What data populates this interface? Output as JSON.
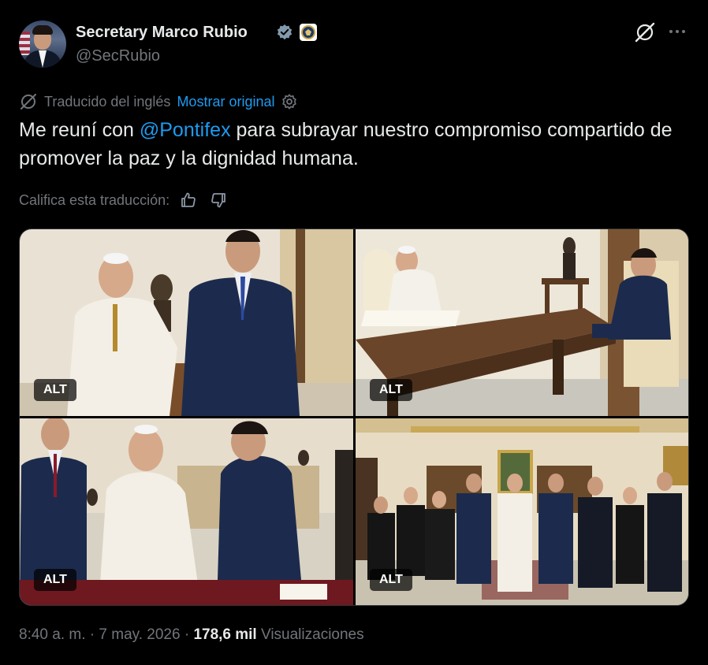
{
  "author": {
    "name": "Secretary Marco Rubio",
    "handle": "@SecRubio",
    "verified_icon": "verified-badge-icon",
    "affiliation_icon": "state-department-seal-icon"
  },
  "translation": {
    "note": "Traducido del inglés",
    "show_original": "Mostrar original",
    "settings_icon": "gear-icon"
  },
  "tweet": {
    "text_before": "Me reuní con ",
    "mention": "@Pontifex",
    "text_after": " para subrayar nuestro compromiso compartido de promover la paz y la dignidad humana."
  },
  "rating": {
    "label": "Califica esta traducción:",
    "like_icon": "thumbs-up-icon",
    "dislike_icon": "thumbs-down-icon"
  },
  "media": [
    {
      "alt_label": "ALT"
    },
    {
      "alt_label": "ALT"
    },
    {
      "alt_label": "ALT"
    },
    {
      "alt_label": "ALT"
    }
  ],
  "meta": {
    "time": "8:40 a. m.",
    "separator": " · ",
    "date": "7 may. 2026",
    "views_count": "178,6 mil",
    "views_label": "Visualizaciones"
  },
  "colors": {
    "background": "#000000",
    "text": "#e7e9ea",
    "muted": "#71767b",
    "accent": "#1d9bf0"
  }
}
